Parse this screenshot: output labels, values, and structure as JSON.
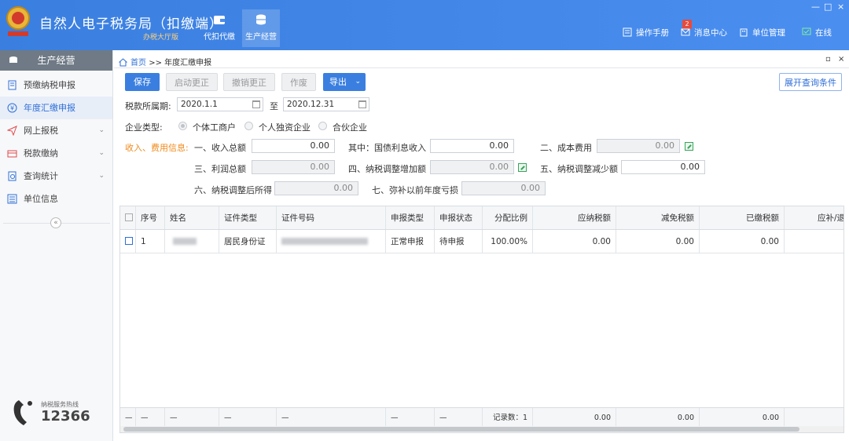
{
  "header": {
    "title": "自然人电子税务局（扣缴端）",
    "subtitle": "办税大厅版",
    "nav": [
      {
        "label": "代扣代缴",
        "icon": "wallet-icon"
      },
      {
        "label": "生产经营",
        "icon": "coins-icon"
      }
    ],
    "items": [
      {
        "label": "操作手册",
        "icon": "manual-icon"
      },
      {
        "label": "消息中心",
        "icon": "mail-icon"
      },
      {
        "label": "单位管理",
        "icon": "building-icon"
      },
      {
        "label": "在线",
        "icon": "online-icon"
      }
    ],
    "badge": "2",
    "window_controls": [
      "—",
      "□",
      "×"
    ]
  },
  "sidebar": {
    "title": "生产经营",
    "items": [
      {
        "label": "预缴纳税申报",
        "icon": "document-icon"
      },
      {
        "label": "年度汇缴申报",
        "icon": "yuan-icon"
      },
      {
        "label": "网上报税",
        "icon": "send-icon"
      },
      {
        "label": "税款缴纳",
        "icon": "payment-icon"
      },
      {
        "label": "查询统计",
        "icon": "query-icon"
      },
      {
        "label": "单位信息",
        "icon": "list-icon"
      }
    ],
    "collapse": "«",
    "hotline_label": "纳税服务热线",
    "hotline_number": "12366"
  },
  "main": {
    "breadcrumb_home": "首页",
    "breadcrumb_sep": ">>",
    "breadcrumb_current": "年度汇缴申报",
    "controls": [
      "▫",
      "×"
    ],
    "buttons": {
      "save": "保存",
      "start_correct": "启动更正",
      "cancel_correct": "撤销更正",
      "void": "作废",
      "export": "导出",
      "expand": "展开查询条件"
    },
    "period_label": "税款所属期:",
    "period_start": "2020.1.1",
    "period_to": "至",
    "period_end": "2020.12.31",
    "enterprise_label": "企业类型:",
    "enterprise_types": [
      "个体工商户",
      "个人独资企业",
      "合伙企业"
    ],
    "income_label": "收入、费用信息:",
    "fields": {
      "income_total_label": "一、收入总额",
      "income_total": "0.00",
      "bond_interest_label": "其中：国债利息收入",
      "bond_interest": "0.00",
      "cost_label": "二、成本费用",
      "cost": "0.00",
      "profit_label": "三、利润总额",
      "profit": "0.00",
      "tax_adj_inc_label": "四、纳税调整增加额",
      "tax_adj_inc": "0.00",
      "tax_adj_dec_label": "五、纳税调整减少额",
      "tax_adj_dec": "0.00",
      "after_adj_label": "六、纳税调整后所得",
      "after_adj": "0.00",
      "loss_label": "七、弥补以前年度亏损",
      "loss": "0.00"
    }
  },
  "table": {
    "columns": [
      "序号",
      "姓名",
      "证件类型",
      "证件号码",
      "申报类型",
      "申报状态",
      "分配比例",
      "应纳税额",
      "减免税额",
      "已缴税额",
      "应补/退"
    ],
    "rows": [
      {
        "no": "1",
        "id_type": "居民身份证",
        "report_type": "正常申报",
        "status": "待申报",
        "ratio": "100.00%",
        "payable": "0.00",
        "relief": "0.00",
        "paid": "0.00"
      }
    ],
    "footer": {
      "dash": "—",
      "count_label": "记录数：1",
      "payable": "0.00",
      "relief": "0.00",
      "paid": "0.00"
    }
  }
}
